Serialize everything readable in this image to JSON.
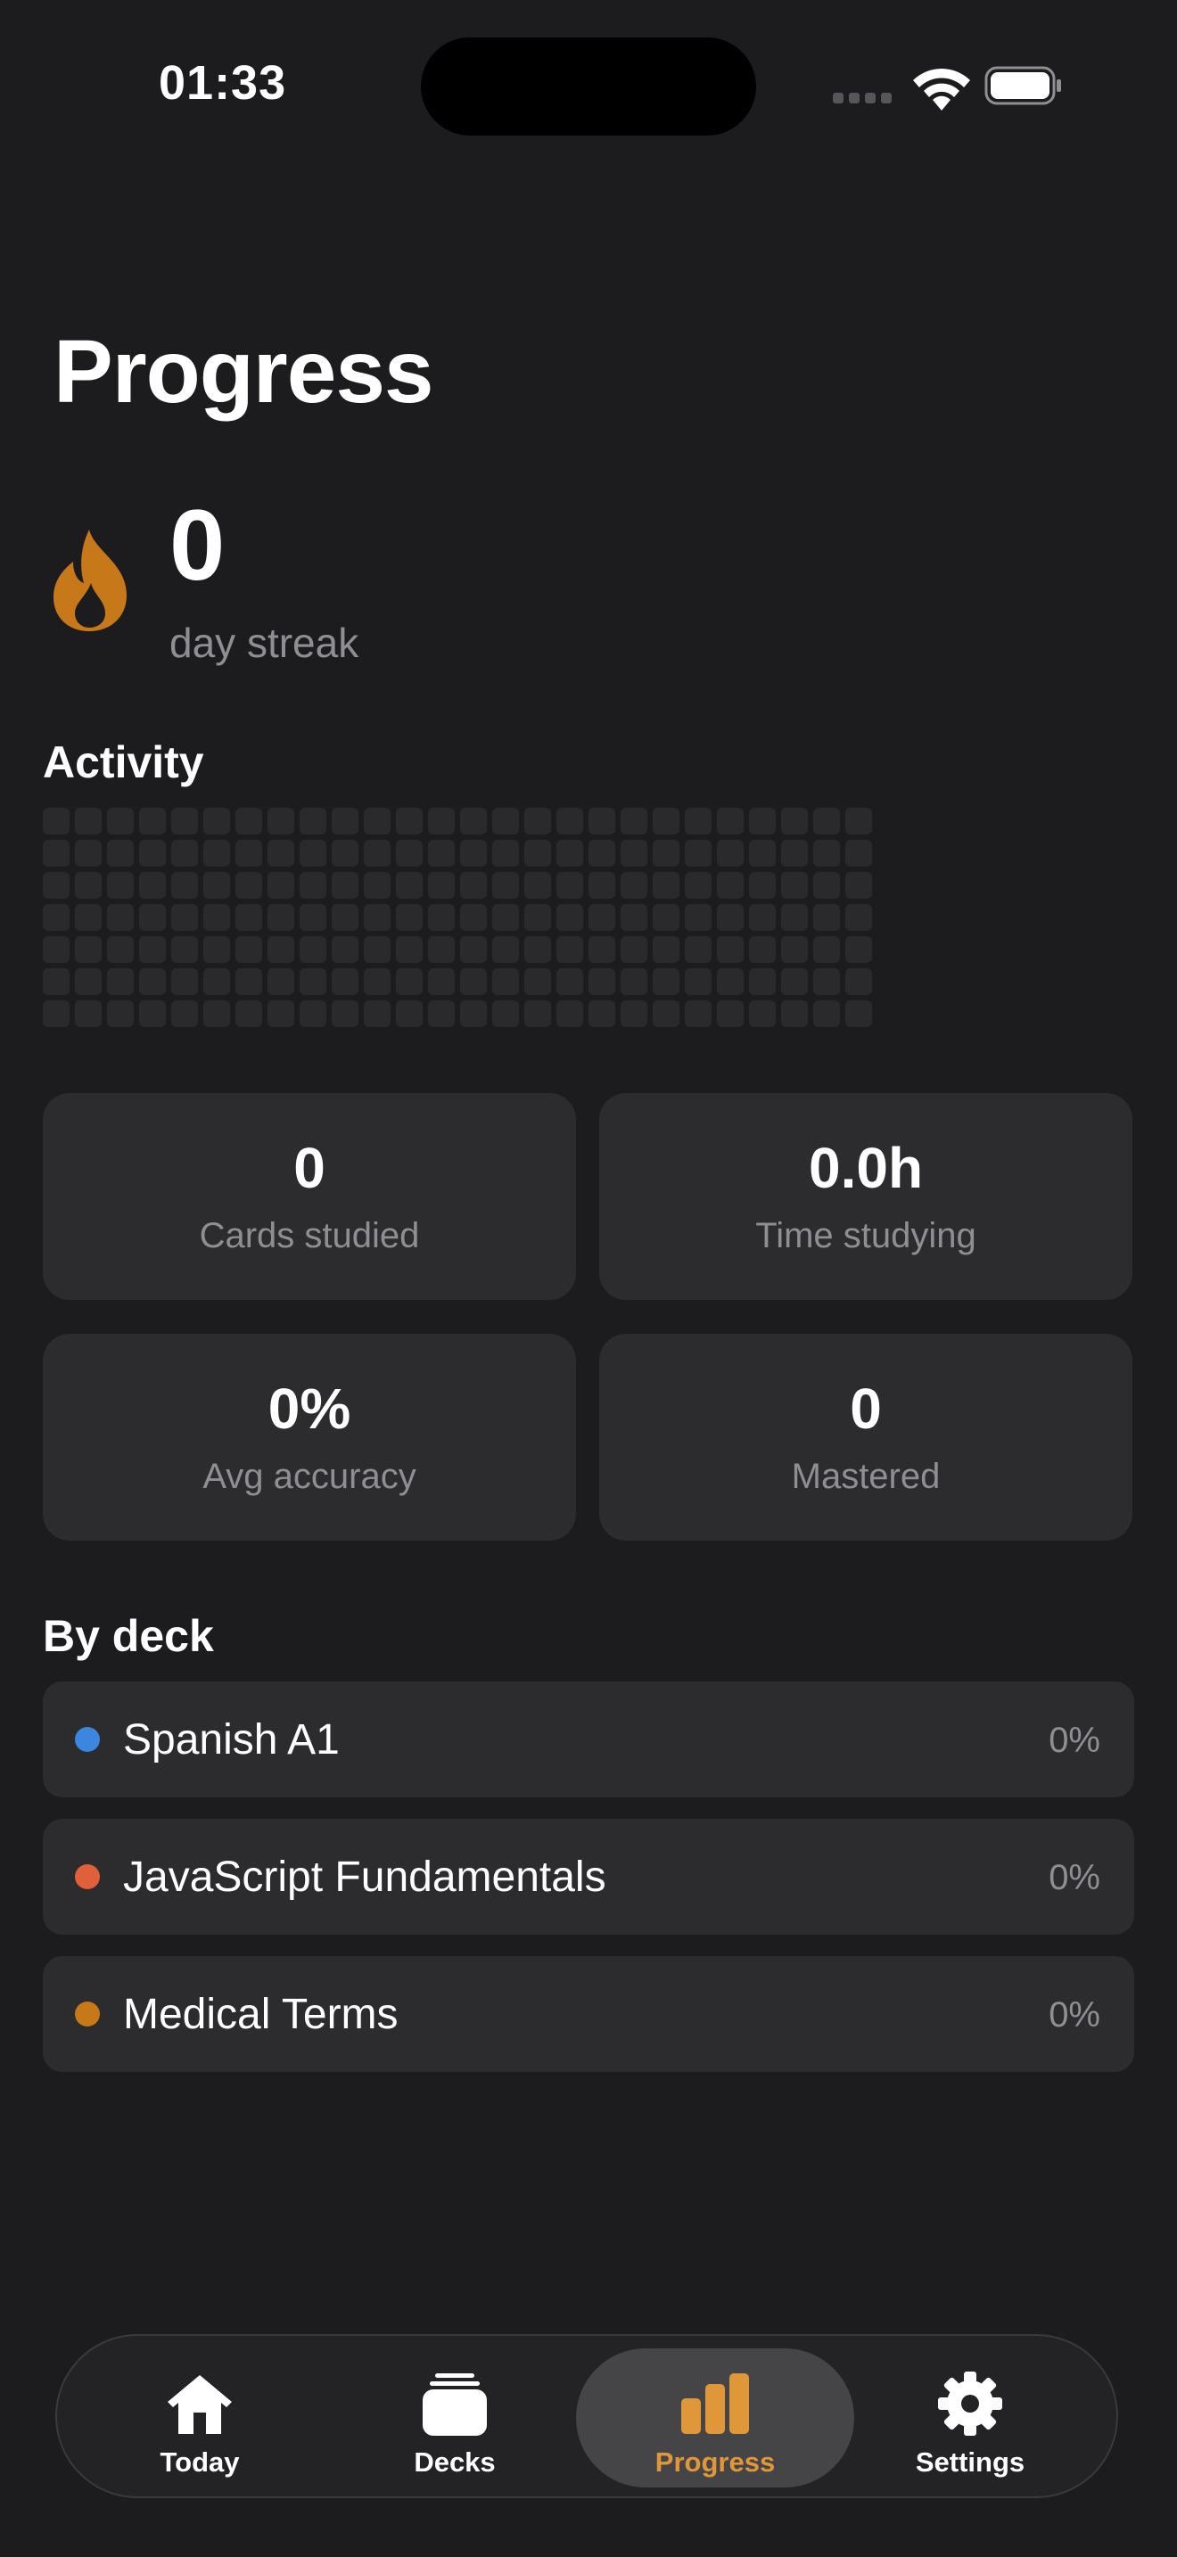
{
  "status": {
    "time": "01:33"
  },
  "page": {
    "title": "Progress"
  },
  "streak": {
    "count": "0",
    "label": "day streak"
  },
  "activity": {
    "title": "Activity",
    "rows": 7,
    "cols": 26,
    "level": 0
  },
  "stats": [
    {
      "value": "0",
      "label": "Cards studied"
    },
    {
      "value": "0.0h",
      "label": "Time studying"
    },
    {
      "value": "0%",
      "label": "Avg accuracy"
    },
    {
      "value": "0",
      "label": "Mastered"
    }
  ],
  "by_deck": {
    "title": "By deck",
    "decks": [
      {
        "name": "Spanish A1",
        "percent": "0%",
        "color": "#3b86de"
      },
      {
        "name": "JavaScript Fundamentals",
        "percent": "0%",
        "color": "#e0603a"
      },
      {
        "name": "Medical Terms",
        "percent": "0%",
        "color": "#c7791a"
      }
    ]
  },
  "tabs": [
    {
      "label": "Today",
      "icon": "house-icon",
      "active": false
    },
    {
      "label": "Decks",
      "icon": "stack-icon",
      "active": false
    },
    {
      "label": "Progress",
      "icon": "bar-chart-icon",
      "active": true
    },
    {
      "label": "Settings",
      "icon": "gear-icon",
      "active": false
    }
  ],
  "colors": {
    "accent": "#e0973a",
    "background": "#1c1c1e",
    "card": "#2c2c2e"
  }
}
